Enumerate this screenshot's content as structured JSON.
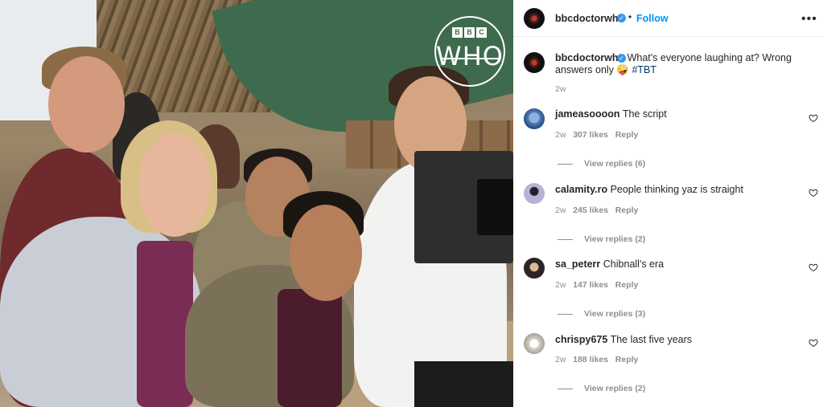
{
  "post": {
    "author": "bbcdoctorwho",
    "follow_label": "Follow",
    "separator": "•",
    "more_label": "•••",
    "verified_mark": "✓",
    "image": {
      "logo_bbc_letters": [
        "B",
        "B",
        "C"
      ],
      "logo_text": "WHO"
    }
  },
  "caption": {
    "username": "bbcdoctorwho",
    "text": " What's everyone laughing at? Wrong answers only 🤪 ",
    "hashtag": "#TBT",
    "time": "2w"
  },
  "comments": [
    {
      "username": "jameasoooon",
      "text": "The script",
      "time": "2w",
      "likes": "307 likes",
      "reply_label": "Reply",
      "view_replies": "View replies (6)",
      "avatar_icon": "profile-photo-icon"
    },
    {
      "username": "calamity.ro",
      "text": "People thinking yaz is straight",
      "time": "2w",
      "likes": "245 likes",
      "reply_label": "Reply",
      "view_replies": "View replies (2)",
      "avatar_icon": "profile-photo-icon"
    },
    {
      "username": "sa_peterr",
      "text": "Chibnall's era",
      "time": "2w",
      "likes": "147 likes",
      "reply_label": "Reply",
      "view_replies": "View replies (3)",
      "avatar_icon": "profile-photo-icon"
    },
    {
      "username": "chrispy675",
      "text": "The last five years",
      "time": "2w",
      "likes": "188 likes",
      "reply_label": "Reply",
      "view_replies": "View replies (2)",
      "avatar_icon": "profile-photo-icon"
    }
  ],
  "colors": {
    "accent": "#0095f6",
    "verified": "#3897f0",
    "text": "#262626",
    "muted": "#8e8e8e"
  }
}
